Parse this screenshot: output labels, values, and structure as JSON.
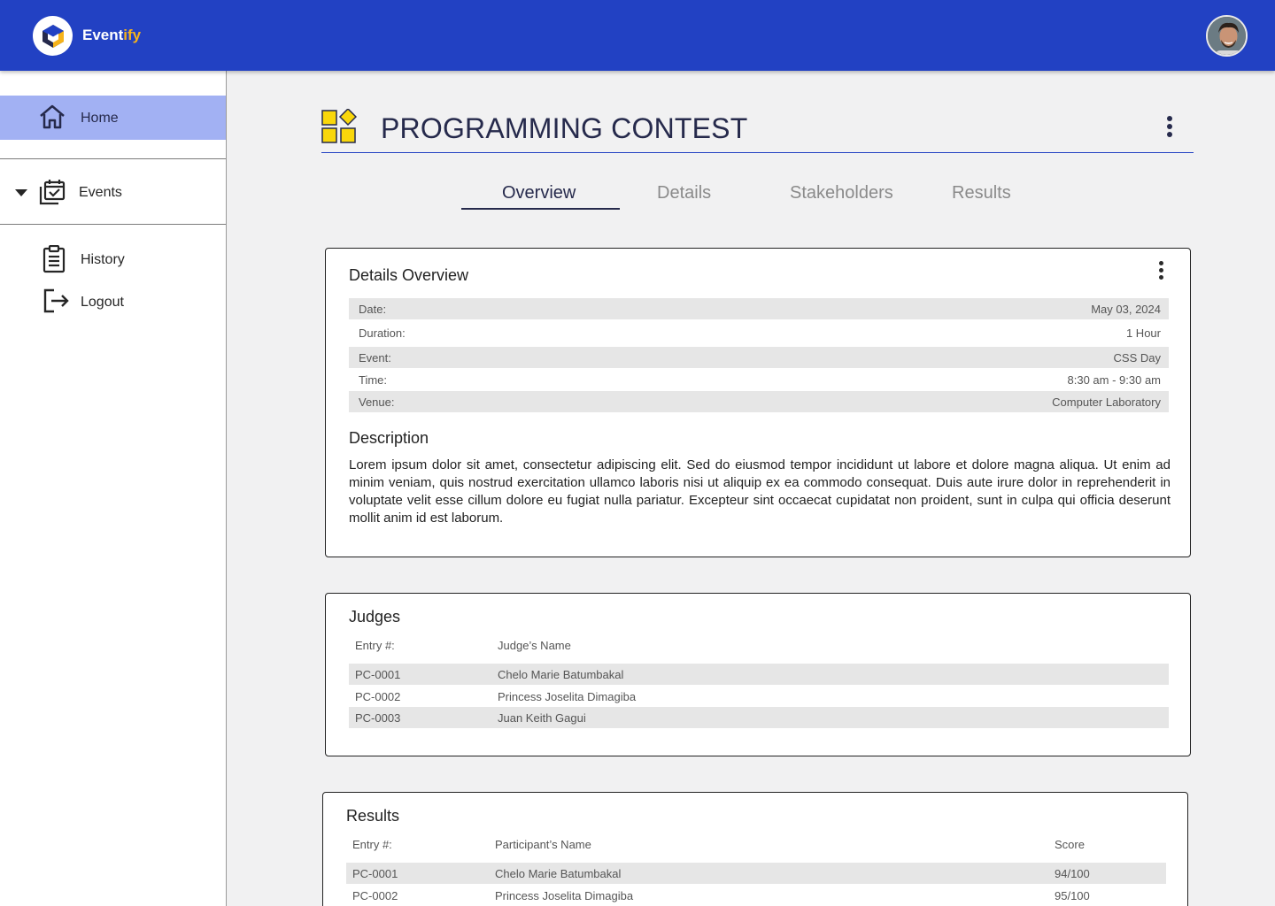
{
  "header": {
    "brand_main": "Event",
    "brand_accent": "ify",
    "colors": {
      "primary": "#2241c3",
      "accent": "#f6b31a",
      "nav_active": "#a2b1f3"
    }
  },
  "sidebar": {
    "home": {
      "label": "Home",
      "icon": "home-icon"
    },
    "events": {
      "label": "Events",
      "icon": "calendar-check-icon"
    },
    "history": {
      "label": "History",
      "icon": "clipboard-icon"
    },
    "logout": {
      "label": "Logout",
      "icon": "logout-icon"
    }
  },
  "page": {
    "title": "PROGRAMMING CONTEST",
    "tabs": [
      {
        "label": "Overview",
        "active": true
      },
      {
        "label": "Details",
        "active": false
      },
      {
        "label": "Stakeholders",
        "active": false
      },
      {
        "label": "Results",
        "active": false
      }
    ]
  },
  "details": {
    "title": "Details Overview",
    "rows": [
      {
        "key": "Date:",
        "value": "May 03, 2024"
      },
      {
        "key": "Duration:",
        "value": "1 Hour"
      },
      {
        "key": "Event:",
        "value": "CSS Day"
      },
      {
        "key": "Time:",
        "value": "8:30 am - 9:30 am"
      },
      {
        "key": "Venue:",
        "value": "Computer Laboratory"
      }
    ],
    "description_title": "Description",
    "description": "Lorem ipsum dolor sit amet, consectetur adipiscing elit. Sed do eiusmod tempor incididunt ut labore et dolore magna aliqua. Ut enim ad minim veniam, quis nostrud exercitation ullamco laboris nisi ut aliquip ex ea commodo consequat. Duis aute irure dolor in reprehenderit in voluptate velit esse cillum dolore eu fugiat nulla pariatur. Excepteur sint occaecat cupidatat non proident, sunt in culpa qui officia deserunt mollit anim id est laborum."
  },
  "judges": {
    "title": "Judges",
    "columns": [
      "Entry #:",
      "Judge’s Name"
    ],
    "rows": [
      {
        "entry": "PC-0001",
        "name": "Chelo Marie Batumbakal"
      },
      {
        "entry": "PC-0002",
        "name": "Princess Joselita Dimagiba"
      },
      {
        "entry": "PC-0003",
        "name": "Juan Keith Gagui"
      }
    ]
  },
  "results": {
    "title": "Results",
    "columns": [
      "Entry #:",
      "Participant’s Name",
      "Score"
    ],
    "rows": [
      {
        "entry": "PC-0001",
        "name": "Chelo Marie Batumbakal",
        "score": "94/100"
      },
      {
        "entry": "PC-0002",
        "name": "Princess Joselita Dimagiba",
        "score": "95/100"
      }
    ]
  }
}
